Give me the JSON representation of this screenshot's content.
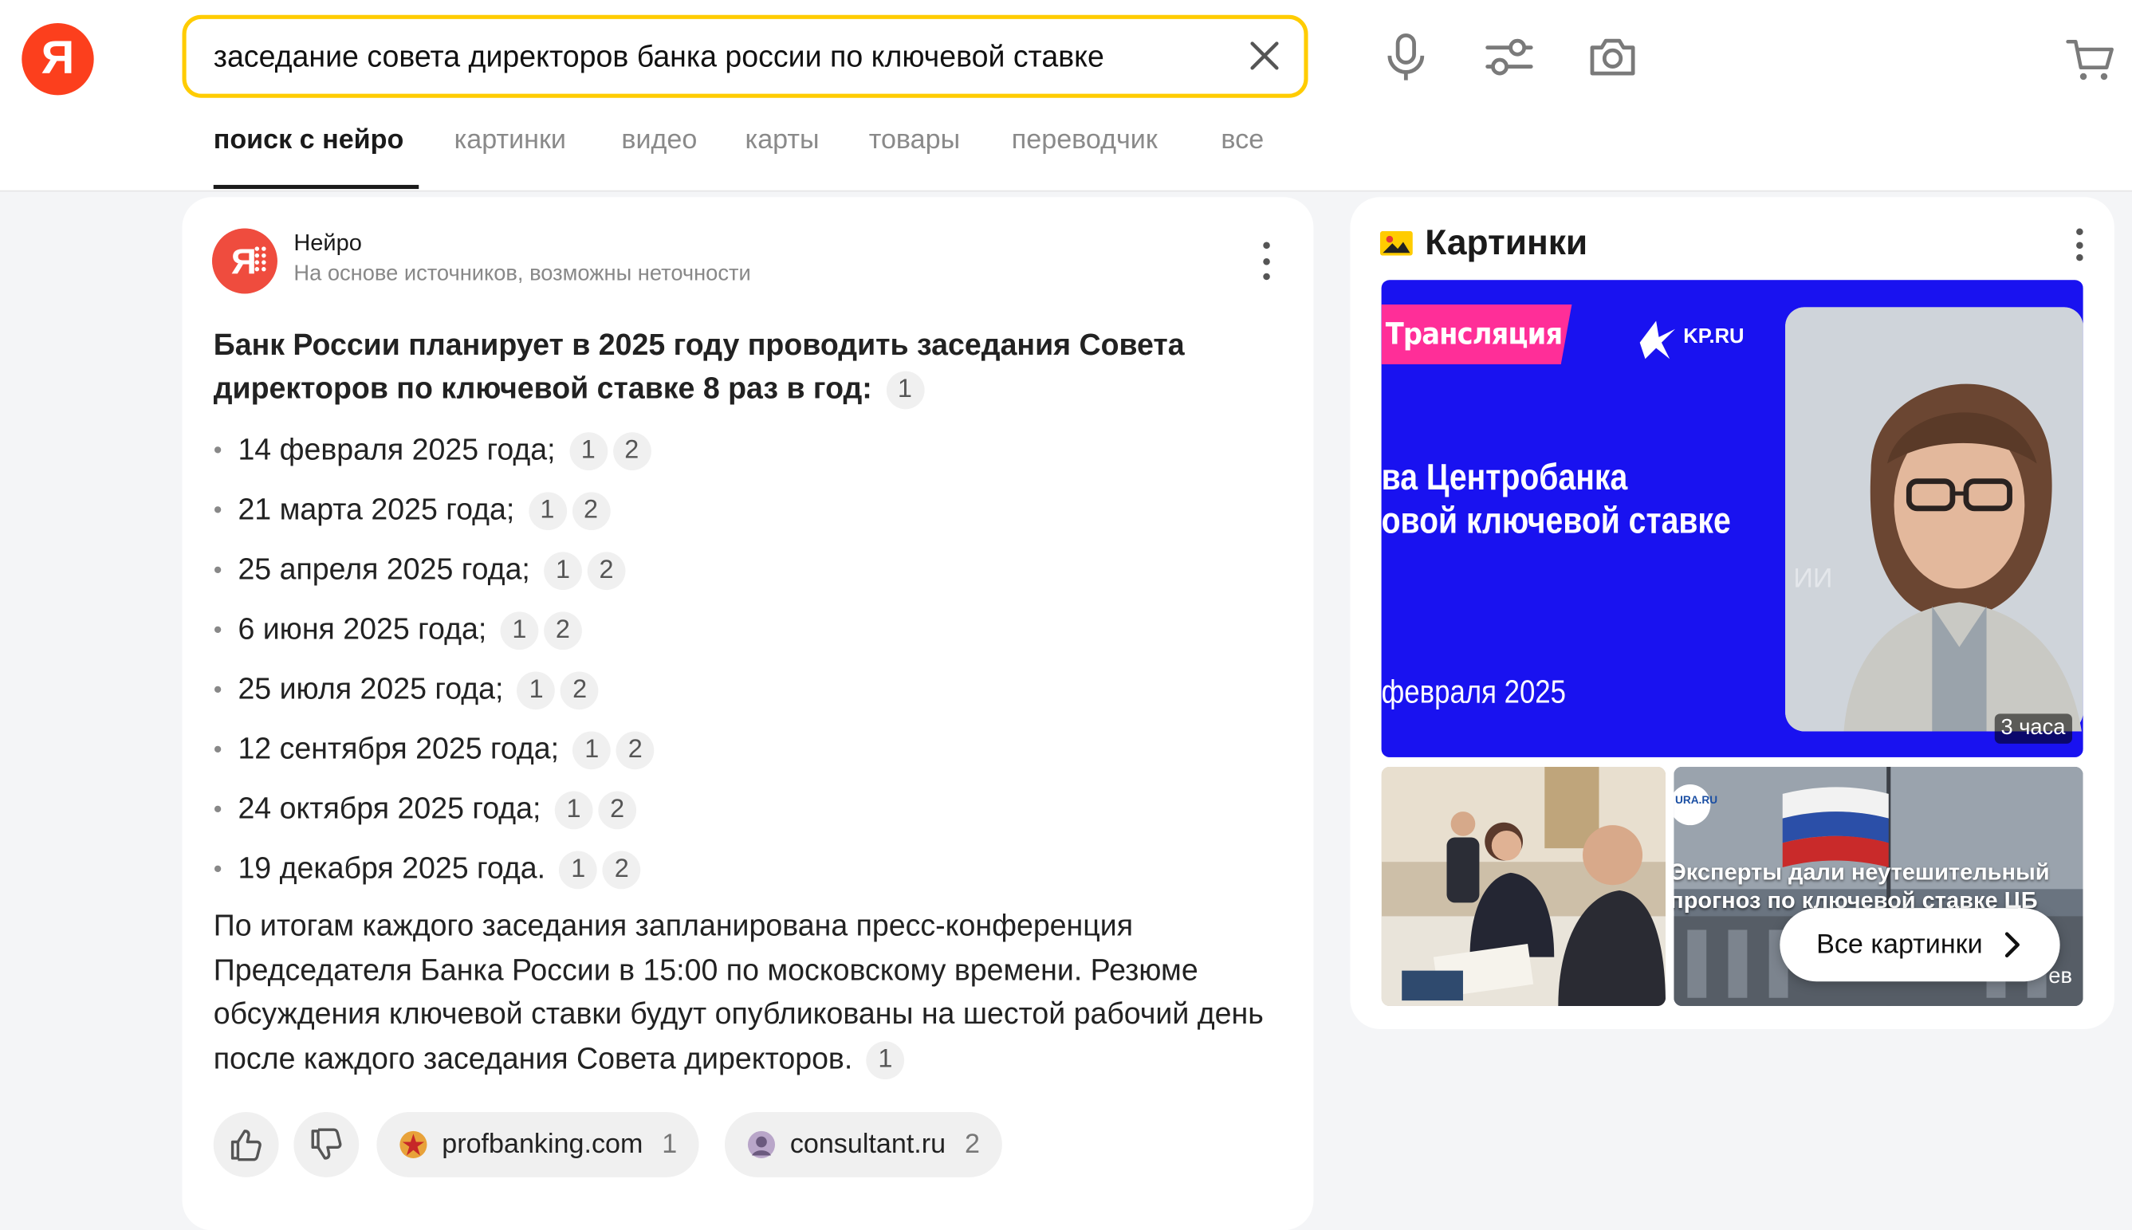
{
  "logo": {
    "glyph": "Я",
    "color": "#fc3f1d"
  },
  "search": {
    "value": "заседание совета директоров банка россии по ключевой ставке",
    "border_color": "#ffcc00"
  },
  "toolbar": {
    "icons": [
      "microphone-icon",
      "filters-icon",
      "camera-icon",
      "cart-icon"
    ]
  },
  "tabs": [
    {
      "label": "поиск с нейро",
      "active": true
    },
    {
      "label": "картинки"
    },
    {
      "label": "видео"
    },
    {
      "label": "карты"
    },
    {
      "label": "товары"
    },
    {
      "label": "переводчик"
    },
    {
      "label": "все"
    }
  ],
  "neuro": {
    "name": "Нейро",
    "subtitle": "На основе источников, возможны неточности",
    "headline": "Банк России планирует в 2025 году проводить заседания Совета директоров по ключевой ставке 8 раз в год:",
    "headline_cite": "1",
    "dates": [
      {
        "text": "14 февраля 2025 года;",
        "c1": "1",
        "c2": "2"
      },
      {
        "text": "21 марта 2025 года;",
        "c1": "1",
        "c2": "2"
      },
      {
        "text": "25 апреля 2025 года;",
        "c1": "1",
        "c2": "2"
      },
      {
        "text": "6 июня 2025 года;",
        "c1": "1",
        "c2": "2"
      },
      {
        "text": "25 июля 2025 года;",
        "c1": "1",
        "c2": "2"
      },
      {
        "text": "12 сентября 2025 года;",
        "c1": "1",
        "c2": "2"
      },
      {
        "text": "24 октября 2025 года;",
        "c1": "1",
        "c2": "2"
      },
      {
        "text": "19 декабря 2025 года.",
        "c1": "1",
        "c2": "2"
      }
    ],
    "paragraph": "По итогам каждого заседания запланирована пресс-конференция Председателя Банка России в 15:00 по московскому времени. Резюме обсуждения ключевой ставки будут опубликованы на шестой рабочий день после каждого заседания Совета директоров.",
    "paragraph_cite": "1",
    "sources": [
      {
        "domain": "profbanking.com",
        "num": "1"
      },
      {
        "domain": "consultant.ru",
        "num": "2"
      }
    ]
  },
  "images": {
    "title": "Картинки",
    "big": {
      "tag": "Трансляция",
      "brand": "KP.RU",
      "line1": "ва Центробанка",
      "line2": "овой ключевой ставке",
      "date": "февраля 2025",
      "overlay_fragment": "ИИ",
      "age": "3 часа"
    },
    "thumb2": {
      "source_badge": "URA.RU",
      "caption_line1": "Эксперты дали неутешительный",
      "caption_line2": "прогноз по ключевой ставке ЦБ",
      "corner_fragment": "ев"
    },
    "all_button": "Все картинки"
  }
}
